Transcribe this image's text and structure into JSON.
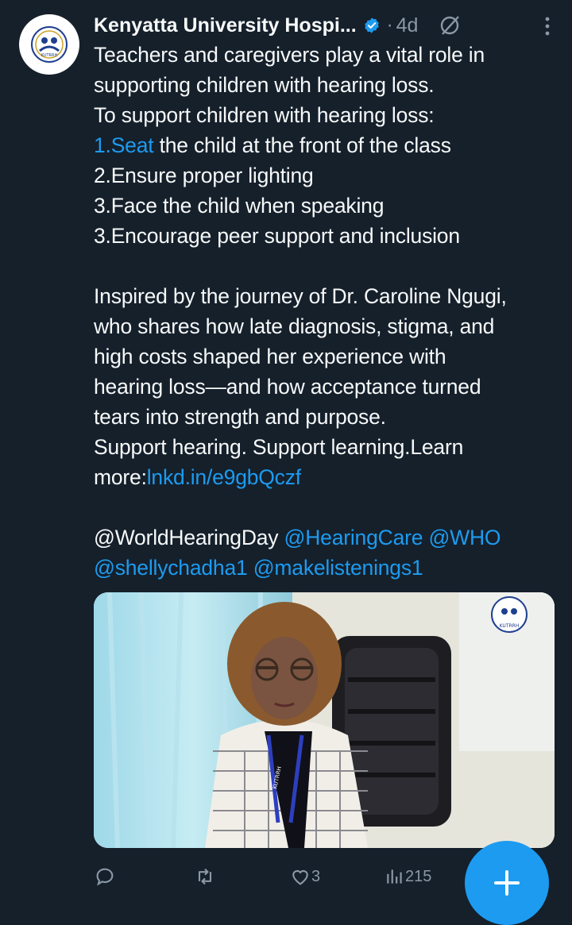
{
  "tweet": {
    "author_name": "Kenyatta University Hospi...",
    "dot": "·",
    "time": "4d",
    "avatar_logo_text": "KUTRRH",
    "lines": [
      "Teachers and caregivers play a vital role in",
      "supporting children with hearing loss.",
      "To support children with hearing loss:",
      "the child at the front of the class",
      "2.Ensure proper lighting",
      "3.Face the child when speaking",
      "3.Encourage peer support and inclusion",
      "Inspired by the journey of Dr. Caroline Ngugi,",
      "who shares how late diagnosis, stigma, and",
      "high costs shaped her experience with",
      "hearing loss—and how acceptance turned",
      "tears into strength and purpose.",
      "Support hearing. Support learning.Learn",
      "more:"
    ],
    "seat_link": "1.Seat",
    "url_link": "lnkd.in/e9gbQczf",
    "mention_plain": "@WorldHearingDay",
    "mention_1": "@HearingCare",
    "mention_2": "@WHO",
    "mention_3": "@shellychadha1",
    "mention_4": "@makelistenings1"
  },
  "media": {
    "video_logo_text": "KUTRRH",
    "lanyard_text": "KUTRRH"
  },
  "actions": {
    "reply_count": "",
    "retweet_count": "",
    "like_count": "3",
    "view_count": "215"
  },
  "colors": {
    "background": "#15202b",
    "accent": "#1d9bf0",
    "text": "#f7f9f9",
    "muted": "#8b98a5"
  }
}
